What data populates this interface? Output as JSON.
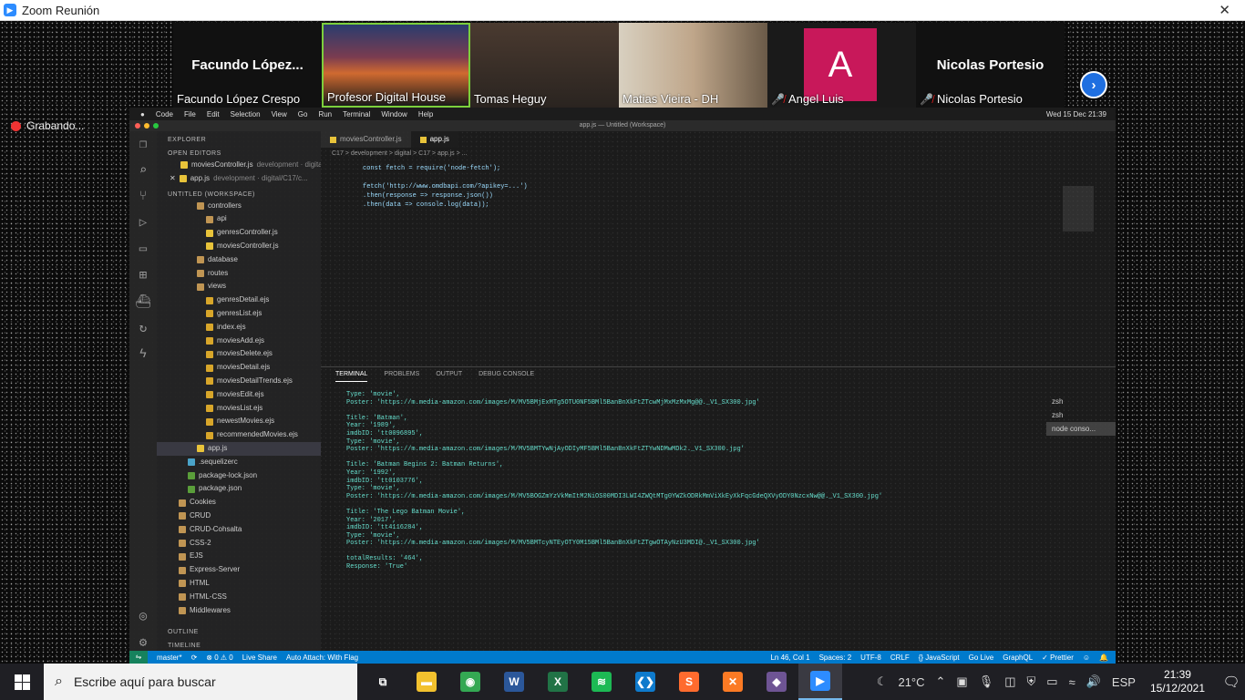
{
  "zoom": {
    "window_title": "Zoom Reunión",
    "close_glyph": "✕",
    "recording_label": "Grabando...",
    "participants": [
      {
        "name": "Facundo López Crespo",
        "tile_title": "Facundo  López..."
      },
      {
        "name": "Profesor Digital House"
      },
      {
        "name": "Tomas Heguy"
      },
      {
        "name": "Matias Vieira - DH"
      },
      {
        "name": "Angel Luis",
        "avatar_letter": "A",
        "avatar_color": "#c8185a"
      },
      {
        "name": "Nicolas Portesio",
        "tile_title": "Nicolas Portesio"
      }
    ],
    "next_page_glyph": "›"
  },
  "vscode": {
    "menu": [
      "Code",
      "File",
      "Edit",
      "Selection",
      "View",
      "Go",
      "Run",
      "Terminal",
      "Window",
      "Help"
    ],
    "clock": "Wed 15 Dec  21:39",
    "window_title": "app.js — Untitled (Workspace)",
    "sidebar": {
      "explorer_label": "EXPLORER",
      "open_editors_label": "OPEN EDITORS",
      "open_editors": [
        {
          "name": "moviesController.js",
          "desc": "development · digital/..."
        },
        {
          "name": "app.js",
          "desc": "development · digital/C17/c..."
        }
      ],
      "workspace_label": "UNTITLED (WORKSPACE)",
      "tree": [
        {
          "name": "controllers",
          "type": "folder",
          "indent": 3
        },
        {
          "name": "api",
          "type": "folder",
          "indent": 4
        },
        {
          "name": "genresController.js",
          "type": "js",
          "indent": 4
        },
        {
          "name": "moviesController.js",
          "type": "js",
          "indent": 4
        },
        {
          "name": "database",
          "type": "folder",
          "indent": 3
        },
        {
          "name": "routes",
          "type": "folder",
          "indent": 3
        },
        {
          "name": "views",
          "type": "folder",
          "indent": 3
        },
        {
          "name": "genresDetail.ejs",
          "type": "ejs",
          "indent": 4
        },
        {
          "name": "genresList.ejs",
          "type": "ejs",
          "indent": 4
        },
        {
          "name": "index.ejs",
          "type": "ejs",
          "indent": 4
        },
        {
          "name": "moviesAdd.ejs",
          "type": "ejs",
          "indent": 4
        },
        {
          "name": "moviesDelete.ejs",
          "type": "ejs",
          "indent": 4
        },
        {
          "name": "moviesDetail.ejs",
          "type": "ejs",
          "indent": 4
        },
        {
          "name": "moviesDetailTrends.ejs",
          "type": "ejs",
          "indent": 4
        },
        {
          "name": "moviesEdit.ejs",
          "type": "ejs",
          "indent": 4
        },
        {
          "name": "moviesList.ejs",
          "type": "ejs",
          "indent": 4
        },
        {
          "name": "newestMovies.ejs",
          "type": "ejs",
          "indent": 4
        },
        {
          "name": "recommendedMovies.ejs",
          "type": "ejs",
          "indent": 4
        },
        {
          "name": "app.js",
          "type": "js",
          "indent": 3,
          "selected": true
        },
        {
          "name": ".sequelizerc",
          "type": "file",
          "indent": 2
        },
        {
          "name": "package-lock.json",
          "type": "json",
          "indent": 2
        },
        {
          "name": "package.json",
          "type": "json",
          "indent": 2
        },
        {
          "name": "Cookies",
          "type": "folder",
          "indent": 1
        },
        {
          "name": "CRUD",
          "type": "folder",
          "indent": 1
        },
        {
          "name": "CRUD-Cohsalta",
          "type": "folder",
          "indent": 1
        },
        {
          "name": "CSS-2",
          "type": "folder",
          "indent": 1
        },
        {
          "name": "EJS",
          "type": "folder",
          "indent": 1
        },
        {
          "name": "Express-Server",
          "type": "folder",
          "indent": 1
        },
        {
          "name": "HTML",
          "type": "folder",
          "indent": 1
        },
        {
          "name": "HTML-CSS",
          "type": "folder",
          "indent": 1
        },
        {
          "name": "Middlewares",
          "type": "folder",
          "indent": 1
        }
      ],
      "outline_label": "OUTLINE",
      "timeline_label": "TIMELINE"
    },
    "tabs": [
      {
        "name": "moviesController.js",
        "active": false
      },
      {
        "name": "app.js",
        "active": true
      }
    ],
    "breadcrumb": "C17 > development > digital > C17 > app.js > ...",
    "code_lines": [
      "const fetch = require('node-fetch');",
      "",
      "fetch('http://www.omdbapi.com/?apikey=...')",
      "  .then(response => response.json())",
      "  .then(data => console.log(data));"
    ],
    "panel": {
      "tabs": [
        "TERMINAL",
        "PROBLEMS",
        "OUTPUT",
        "DEBUG CONSOLE"
      ],
      "terminal_lines": [
        "Type: 'movie',",
        "Poster: 'https://m.media-amazon.com/images/M/MV5BMjExMTg5OTU0NF5BMl5BanBnXkFtZTcwMjMxMzMxMg@@._V1_SX300.jpg'",
        "",
        "Title: 'Batman',",
        "Year: '1989',",
        "imdbID: 'tt0096895',",
        "Type: 'movie',",
        "Poster: 'https://m.media-amazon.com/images/M/MV5BMTYwNjAyODIyMF5BMl5BanBnXkFtZTYwNDMwMDk2._V1_SX300.jpg'",
        "",
        "Title: 'Batman Begins 2: Batman Returns',",
        "Year: '1992',",
        "imdbID: 'tt0103776',",
        "Type: 'movie',",
        "Poster: 'https://m.media-amazon.com/images/M/MV5BOGZmYzVkMmItM2NiOS00MDI3LWI4ZWQtMTg0YWZkODRkMmViXkEyXkFqcGdeQXVyODY0NzcxNw@@._V1_SX300.jpg'",
        "",
        "Title: 'The Lego Batman Movie',",
        "Year: '2017',",
        "imdbID: 'tt4116284',",
        "Type: 'movie',",
        "Poster: 'https://m.media-amazon.com/images/M/MV5BMTcyNTEyOTY0M15BMl5BanBnXkFtZTgwOTAyNzU3MDI@._V1_SX300.jpg'",
        "",
        "totalResults: '464',",
        "Response: 'True'"
      ],
      "terminal_list": [
        "zsh",
        "zsh",
        "node  conso..."
      ]
    },
    "status": {
      "branch": "master*",
      "errors": "⊗ 0 ⚠ 0",
      "live_share": "Live Share",
      "auto_attach": "Auto Attach: With Flag",
      "position": "Ln 46, Col 1",
      "spaces": "Spaces: 2",
      "encoding": "UTF-8",
      "eol": "CRLF",
      "language": "{} JavaScript",
      "go_live": "Go Live",
      "graphql": "GraphQL",
      "prettier": "✓ Prettier"
    }
  },
  "taskbar": {
    "search_placeholder": "Escribe aquí para buscar",
    "apps": [
      {
        "name": "task-view",
        "glyph": "⧉",
        "color": "#1f1f24"
      },
      {
        "name": "file-explorer",
        "glyph": "▬",
        "color": "#f2c12e"
      },
      {
        "name": "chrome",
        "glyph": "◉",
        "color": "#34a853"
      },
      {
        "name": "word",
        "glyph": "W",
        "color": "#2b579a"
      },
      {
        "name": "excel",
        "glyph": "X",
        "color": "#217346"
      },
      {
        "name": "spotify",
        "glyph": "≋",
        "color": "#1db954"
      },
      {
        "name": "vscode",
        "glyph": "❮❯",
        "color": "#0e7acc"
      },
      {
        "name": "sublime",
        "glyph": "S",
        "color": "#ff6b2e"
      },
      {
        "name": "xampp",
        "glyph": "✕",
        "color": "#fb7a24"
      },
      {
        "name": "github-desktop",
        "glyph": "◆",
        "color": "#6e5494"
      },
      {
        "name": "zoom",
        "glyph": "▶",
        "color": "#2d8cff",
        "running": true
      }
    ],
    "weather": "21°C",
    "language": "ESP",
    "time": "21:39",
    "date": "15/12/2021"
  }
}
